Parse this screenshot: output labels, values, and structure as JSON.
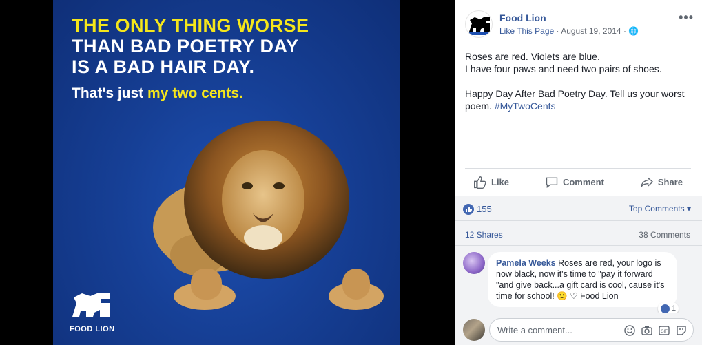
{
  "ad": {
    "headline_line1": "THE ONLY THING WORSE",
    "headline_line2": "THAN BAD POETRY DAY",
    "headline_line3": "IS A BAD HAIR DAY.",
    "tagline_prefix": "That's just",
    "tagline_highlight": "my two cents.",
    "logo_text": "FOOD LION",
    "colors": {
      "bg": "#163f95",
      "accent": "#f5e61b",
      "text": "#ffffff"
    }
  },
  "post": {
    "page_name": "Food Lion",
    "like_page_label": "Like This Page",
    "date": "August 19, 2014",
    "more_icon": "more-dots-icon",
    "text_line1": "Roses are red. Violets are blue.",
    "text_line2": "I have four paws and need two pairs of shoes.",
    "text_para2": "Happy Day After Bad Poetry Day. Tell us your worst poem.",
    "hashtag": "#MyTwoCents",
    "actions": {
      "like": "Like",
      "comment": "Comment",
      "share": "Share"
    }
  },
  "feedback": {
    "reactions_count": "155",
    "top_comments_label": "Top Comments",
    "shares": "12 Shares",
    "comments": "38 Comments",
    "comment": {
      "author": "Pamela Weeks",
      "text": "Roses are red, your logo is now black, now it's time to \"pay it forward \"and give back...a gift card is cool, cause it's time for school! 🙂 ♡ Food Lion",
      "likes": "1"
    },
    "write_placeholder": "Write a comment..."
  }
}
